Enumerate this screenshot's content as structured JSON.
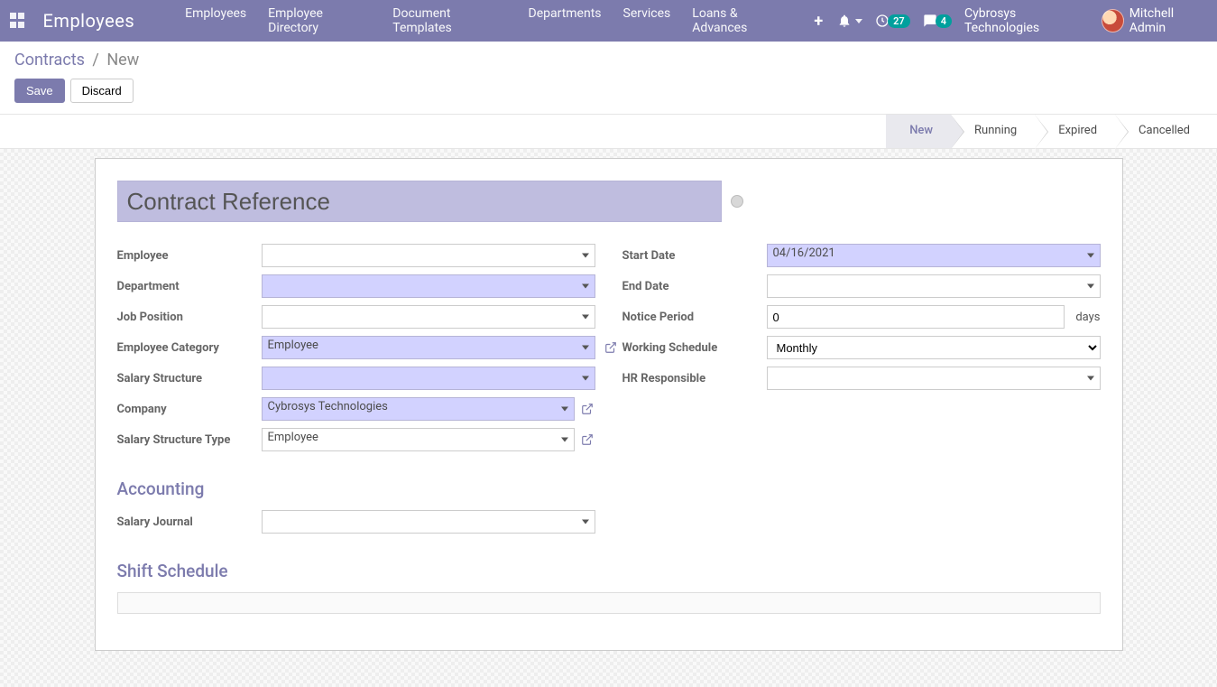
{
  "navbar": {
    "brand": "Employees",
    "links": [
      "Employees",
      "Employee Directory",
      "Document Templates",
      "Departments",
      "Services",
      "Loans & Advances"
    ],
    "activity_badge": "27",
    "discuss_badge": "4",
    "company": "Cybrosys Technologies",
    "user": "Mitchell Admin"
  },
  "breadcrumb": {
    "root": "Contracts",
    "current": "New"
  },
  "buttons": {
    "save": "Save",
    "discard": "Discard"
  },
  "statusbar": {
    "steps": [
      "New",
      "Running",
      "Expired",
      "Cancelled"
    ],
    "active_index": 0
  },
  "form": {
    "title_placeholder": "Contract Reference",
    "left": {
      "employee_label": "Employee",
      "employee_value": "",
      "department_label": "Department",
      "department_value": "",
      "job_position_label": "Job Position",
      "job_position_value": "",
      "employee_category_label": "Employee Category",
      "employee_category_value": "Employee",
      "salary_structure_label": "Salary Structure",
      "salary_structure_value": "",
      "company_label": "Company",
      "company_value": "Cybrosys Technologies",
      "salary_structure_type_label": "Salary Structure Type",
      "salary_structure_type_value": "Employee"
    },
    "right": {
      "start_date_label": "Start Date",
      "start_date_value": "04/16/2021",
      "end_date_label": "End Date",
      "end_date_value": "",
      "notice_period_label": "Notice Period",
      "notice_period_value": "0",
      "notice_period_suffix": "days",
      "working_schedule_label": "Working Schedule",
      "working_schedule_value": "Monthly",
      "hr_responsible_label": "HR Responsible",
      "hr_responsible_value": ""
    }
  },
  "accounting": {
    "section_title": "Accounting",
    "salary_journal_label": "Salary Journal",
    "salary_journal_value": ""
  },
  "shift": {
    "section_title": "Shift Schedule"
  }
}
